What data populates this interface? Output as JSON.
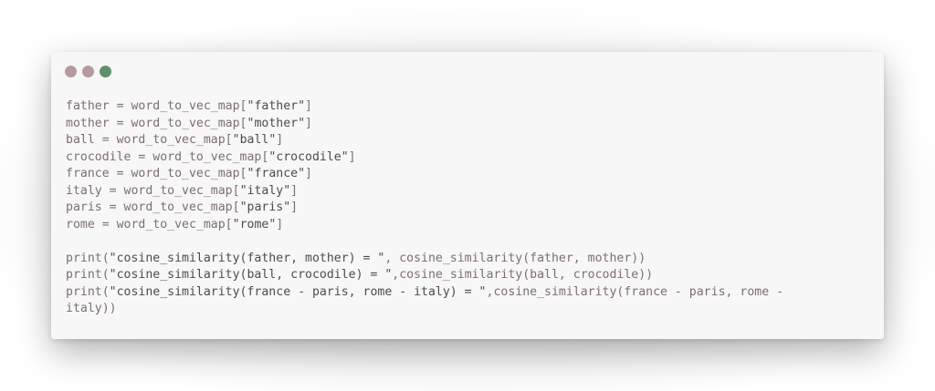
{
  "window": {
    "dots": [
      {
        "name": "close-dot",
        "color": "#b79a9e"
      },
      {
        "name": "minimize-dot",
        "color": "#b79a9e"
      },
      {
        "name": "maximize-dot",
        "color": "#5f8f6c"
      }
    ]
  },
  "code": {
    "lines": [
      {
        "pre": "father = word_to_vec_map[",
        "str": "\"father\"",
        "post": "]"
      },
      {
        "pre": "mother = word_to_vec_map[",
        "str": "\"mother\"",
        "post": "]"
      },
      {
        "pre": "ball = word_to_vec_map[",
        "str": "\"ball\"",
        "post": "]"
      },
      {
        "pre": "crocodile = word_to_vec_map[",
        "str": "\"crocodile\"",
        "post": "]"
      },
      {
        "pre": "france = word_to_vec_map[",
        "str": "\"france\"",
        "post": "]"
      },
      {
        "pre": "italy = word_to_vec_map[",
        "str": "\"italy\"",
        "post": "]"
      },
      {
        "pre": "paris = word_to_vec_map[",
        "str": "\"paris\"",
        "post": "]"
      },
      {
        "pre": "rome = word_to_vec_map[",
        "str": "\"rome\"",
        "post": "]"
      },
      {
        "pre": "",
        "str": "",
        "post": ""
      },
      {
        "pre": "print(",
        "str": "\"cosine_similarity(father, mother) = \"",
        "post": ", cosine_similarity(father, mother))"
      },
      {
        "pre": "print(",
        "str": "\"cosine_similarity(ball, crocodile) = \"",
        "post": ",cosine_similarity(ball, crocodile))"
      },
      {
        "pre": "print(",
        "str": "\"cosine_similarity(france - paris, rome - italy) = \"",
        "post": ",cosine_similarity(france - paris, rome -"
      },
      {
        "pre": "italy))",
        "str": "",
        "post": ""
      }
    ]
  }
}
